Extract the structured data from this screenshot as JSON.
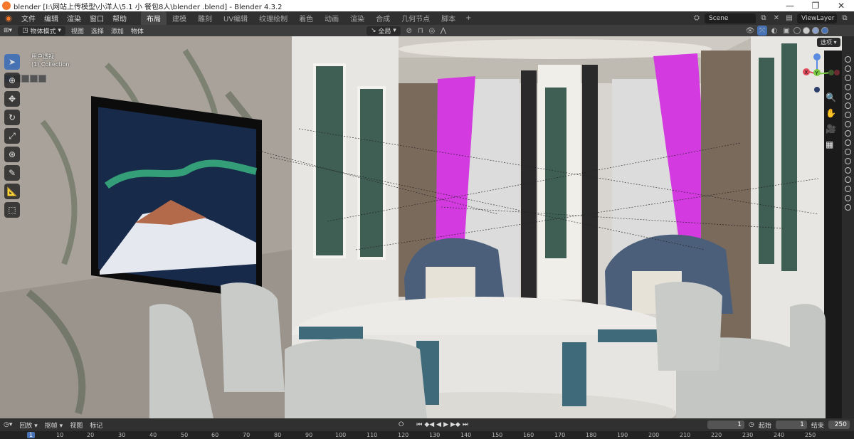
{
  "window": {
    "title": "blender  [I:\\网站上传模型\\小洋人\\5.1  小 餐包8人\\blender .blend] - Blender 4.3.2",
    "minimize": "—",
    "maximize": "❐",
    "close": "✕"
  },
  "menubar": {
    "items": [
      "文件",
      "编辑",
      "渲染",
      "窗口",
      "帮助"
    ],
    "workspaces": [
      "布局",
      "建模",
      "雕刻",
      "UV编辑",
      "纹理绘制",
      "着色",
      "动画",
      "渲染",
      "合成",
      "几何节点",
      "脚本"
    ],
    "active_workspace": "布局",
    "scene": "Scene",
    "view_layer": "ViewLayer"
  },
  "viewport_header": {
    "mode": "物体模式",
    "items": [
      "视图",
      "选择",
      "添加",
      "物体"
    ],
    "transform_orientation": "全局",
    "options": "选项"
  },
  "viewport": {
    "view_name": "用户透视",
    "collection": "(1) Collection"
  },
  "gizmo": {
    "x": "X",
    "y": "Y",
    "z": "Z"
  },
  "timeline": {
    "playback": "回放",
    "keying": "抠帧",
    "view": "视图",
    "marker": "标记",
    "current_frame": "1",
    "start_label": "起始",
    "start": "1",
    "end_label": "结束",
    "end": "250",
    "ruler": [
      "1",
      "10",
      "20",
      "30",
      "40",
      "50",
      "60",
      "70",
      "80",
      "90",
      "100",
      "110",
      "120",
      "130",
      "140",
      "150",
      "160",
      "170",
      "180",
      "190",
      "200",
      "210",
      "220",
      "230",
      "240",
      "250"
    ]
  },
  "colors": {
    "accent": "#4772b3",
    "blender_orange": "#f5792a",
    "curtain_magenta": "#d33be0"
  }
}
